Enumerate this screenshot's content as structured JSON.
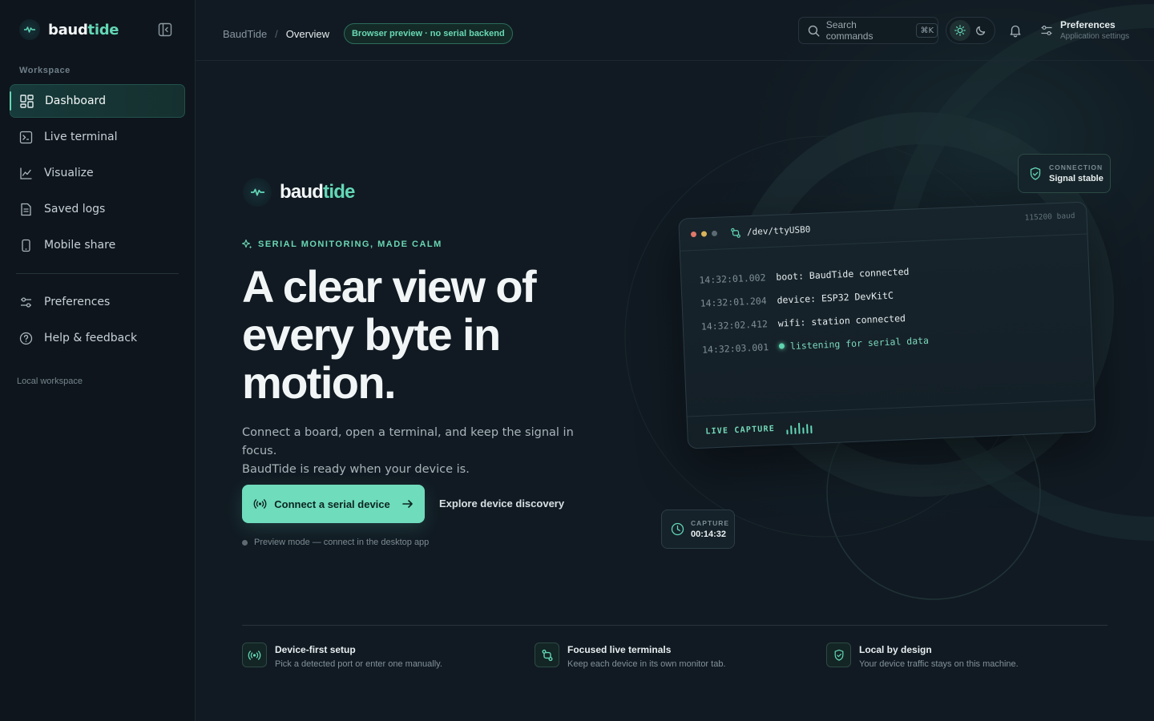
{
  "brand": {
    "name_a": "baud",
    "name_b": "tide"
  },
  "sidebar": {
    "section_label": "Workspace",
    "items": [
      {
        "label": "Dashboard",
        "icon": "dashboard-icon",
        "active": true
      },
      {
        "label": "Live terminal",
        "icon": "terminal-icon"
      },
      {
        "label": "Visualize",
        "icon": "chart-line-icon"
      },
      {
        "label": "Saved logs",
        "icon": "document-icon"
      },
      {
        "label": "Mobile share",
        "icon": "mobile-icon"
      }
    ],
    "secondary_items": [
      {
        "label": "Preferences",
        "icon": "sliders-icon"
      },
      {
        "label": "Help & feedback",
        "icon": "help-icon"
      }
    ],
    "footer": "Local workspace"
  },
  "topbar": {
    "breadcrumb_root": "BaudTide",
    "breadcrumb_sep": "/",
    "breadcrumb_current": "Overview",
    "preview_badge": "Browser preview · no serial backend",
    "search_placeholder": "Search commands",
    "search_shortcut": "⌘K",
    "prefs_title": "Preferences",
    "prefs_subtitle": "Application settings"
  },
  "hero": {
    "logo_a": "baud",
    "logo_b": "tide",
    "eyebrow": "SERIAL MONITORING, MADE CALM",
    "headline": "A clear view of every byte in motion.",
    "lede_line1": "Connect a board, open a terminal, and keep the signal in focus.",
    "lede_line2": "BaudTide is ready when your device is.",
    "cta_primary": "Connect a serial device",
    "cta_secondary": "Explore device discovery",
    "preview_note": "Preview mode — connect in the desktop app"
  },
  "terminal": {
    "port": "/dev/ttyUSB0",
    "baud": "115200 baud",
    "lines": [
      {
        "ts": "14:32:01.002",
        "msg": "boot: BaudTide connected"
      },
      {
        "ts": "14:32:01.204",
        "msg": "device: ESP32 DevKitC"
      },
      {
        "ts": "14:32:02.412",
        "msg": "wifi: station connected"
      },
      {
        "ts": "14:32:03.001",
        "msg": "listening for serial data"
      }
    ],
    "footer_label": "LIVE CAPTURE",
    "activity_levels": [
      0.45,
      0.8,
      0.6,
      1.0,
      0.55,
      0.85,
      0.7
    ]
  },
  "connection_card": {
    "label": "CONNECTION",
    "value": "Signal stable"
  },
  "capture_card": {
    "label": "CAPTURE",
    "value": "00:14:32"
  },
  "features": [
    {
      "title": "Device-first setup",
      "desc": "Pick a detected port or enter one manually.",
      "icon": "signal-icon"
    },
    {
      "title": "Focused live terminals",
      "desc": "Keep each device in its own monitor tab.",
      "icon": "port-icon"
    },
    {
      "title": "Local by design",
      "desc": "Your device traffic stays on this machine.",
      "icon": "shield-icon"
    }
  ],
  "colors": {
    "accent": "#63d7b6",
    "background": "#111a22",
    "sidebar": "#0e151c",
    "cta": "#6fdcbc"
  }
}
